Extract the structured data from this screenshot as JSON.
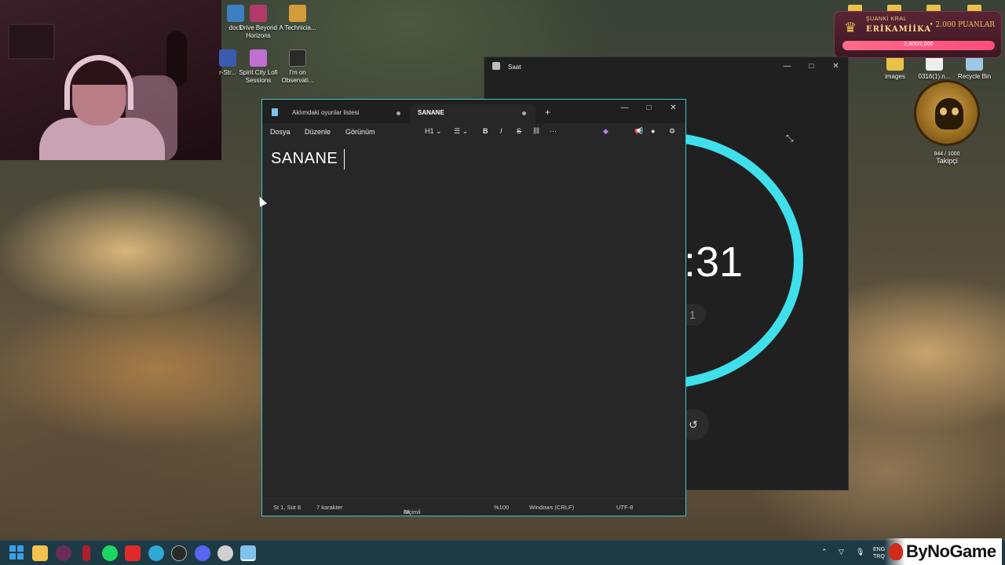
{
  "desktop": {
    "icons": [
      {
        "label": "dock",
        "color": "#3d7fc0"
      },
      {
        "label": "Drive Beyond Horizons",
        "color": "#b23a6a"
      },
      {
        "label": "A Technicia...",
        "color": "#d49b3a"
      },
      {
        "label": "r-Str...",
        "color": "#3b5bb0"
      },
      {
        "label": "Spirit City Lofi Sessions",
        "color": "#c06fd1"
      },
      {
        "label": "I'm on Observati...",
        "color": "#2a2a2a"
      },
      {
        "label": "images",
        "color": "#e9c24a"
      },
      {
        "label": "0316(1).n...",
        "color": "#eeeeee"
      },
      {
        "label": "Recycle Bin",
        "color": "#9ec8e6"
      }
    ]
  },
  "widget": {
    "label": "ŞUANKİ KRAL",
    "name": "ERİKAMİİKA",
    "points": "• 2.000 PUANLAR",
    "progress_text": "2,000/2,000",
    "progress_fraction": 1.0,
    "follower_count": "944 / 1000",
    "follower_label": "Takipçi"
  },
  "clock_window": {
    "title": "Saat",
    "time_visible": ":31",
    "sub_visible": "1",
    "buttons": {
      "minimize": "—",
      "maximize": "□",
      "close": "✕"
    },
    "accent": "#3fe0eb"
  },
  "notepad": {
    "tabs": [
      {
        "label": "Aklımdaki oyunlar listesi",
        "active": false
      },
      {
        "label": "SANANE",
        "active": true
      }
    ],
    "new_tab": "+",
    "menus": [
      "Dosya",
      "Düzenle",
      "Görünüm"
    ],
    "toolbar": {
      "heading": "H1",
      "list": "☰",
      "bold": "B",
      "italic": "I",
      "strike": "S",
      "link": "🔗",
      "more": "···"
    },
    "content": "SANANE",
    "status": {
      "position": "St 1, Süt 8",
      "chars": "7 karakter",
      "format": "Biçimli",
      "zoom": "%100",
      "line_ending": "Windows (CRLF)",
      "encoding": "UTF-8"
    },
    "window_buttons": {
      "minimize": "—",
      "maximize": "□",
      "close": "✕"
    }
  },
  "taskbar": {
    "apps": [
      {
        "name": "start",
        "color": "#3aa0e8"
      },
      {
        "name": "file-explorer",
        "color": "#f2c14e"
      },
      {
        "name": "app-circle",
        "color": "#6a2c5c"
      },
      {
        "name": "app-red",
        "color": "#b01e2a"
      },
      {
        "name": "spotify",
        "color": "#1ed760"
      },
      {
        "name": "youtube",
        "color": "#e02b2b"
      },
      {
        "name": "edge",
        "color": "#2fa8d8"
      },
      {
        "name": "steam",
        "color": "#2a2a2a"
      },
      {
        "name": "discord",
        "color": "#5865f2"
      },
      {
        "name": "clock",
        "color": "#d0d0d0"
      },
      {
        "name": "notepad",
        "color": "#7fc3e8"
      }
    ],
    "lang": "ENG TRQ",
    "watermark": "ByNoGame"
  }
}
